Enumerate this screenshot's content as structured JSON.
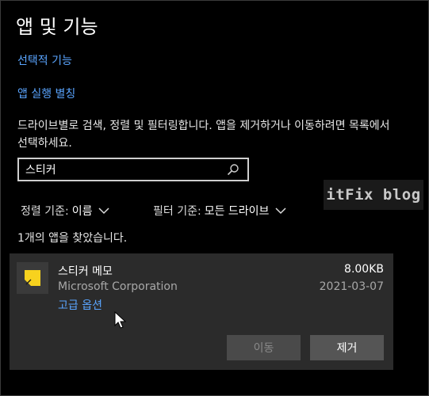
{
  "page": {
    "title": "앱 및 기능",
    "links": {
      "optional_features": "선택적 기능",
      "app_aliases": "앱 실행 별칭"
    },
    "description": "드라이브별로 검색, 정렬 및 필터링합니다. 앱을 제거하거나 이동하려면 목록에서 선택하세요.",
    "search": {
      "value": "스티커",
      "icon": "search-icon"
    },
    "sort": {
      "label": "정렬 기준:",
      "value": "이름"
    },
    "filter": {
      "label": "필터 기준:",
      "value": "모든 드라이브"
    },
    "result_count": "1개의 앱을 찾았습니다.",
    "watermark": "itFix blog"
  },
  "apps": [
    {
      "name": "스티커 메모",
      "publisher": "Microsoft Corporation",
      "advanced_options": "고급 옵션",
      "size": "8.00KB",
      "date": "2021-03-07",
      "icon": "sticky-notes-icon",
      "buttons": {
        "move": "이동",
        "uninstall": "제거"
      }
    }
  ],
  "colors": {
    "background": "#000000",
    "link": "#5aa5ff",
    "card": "#2b2b2b",
    "accent_yellow": "#f7d21e"
  }
}
